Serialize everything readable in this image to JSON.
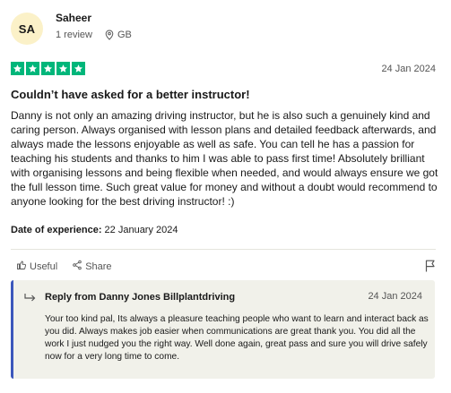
{
  "reviewer": {
    "initials": "SA",
    "name": "Saheer",
    "review_count": "1 review",
    "location": "GB"
  },
  "review": {
    "rating": 5,
    "date": "24 Jan 2024",
    "title": "Couldn’t have asked for a better instructor!",
    "body": "Danny is not only an amazing driving instructor, but he is also such a genuinely kind and caring person. Always organised with lesson plans and detailed feedback afterwards, and always made the lessons enjoyable as well as safe. You can tell he has a passion for teaching his students and thanks to him I was able to pass first time! Absolutely brilliant with organising lessons and being flexible when needed, and would always ensure we got the full lesson time. Such great value for money and without a doubt would recommend to anyone looking for the best driving instructor! :)",
    "experience_label": "Date of experience:",
    "experience_date": "22 January 2024",
    "star_color": "#00b67a"
  },
  "actions": {
    "useful_label": "Useful",
    "share_label": "Share"
  },
  "reply": {
    "title": "Reply from Danny Jones Billplantdriving",
    "date": "24 Jan 2024",
    "body": "Your too kind pal, Its always a pleasure teaching people who want to learn and interact back as you did. Always makes job easier when communications are great thank you. You did all the work I just nudged you the right way. Well done again, great pass and sure you will drive safely now for a very long time to come.",
    "accent_color": "#3c57bc"
  }
}
